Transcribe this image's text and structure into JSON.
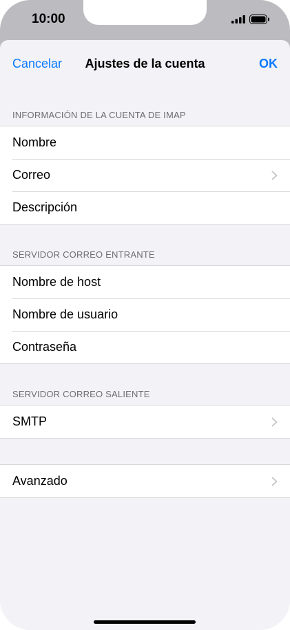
{
  "status_bar": {
    "time": "10:00",
    "signal_icon": "cellular-signal-icon",
    "battery_icon": "battery-icon"
  },
  "nav": {
    "cancel_label": "Cancelar",
    "title": "Ajustes de la cuenta",
    "ok_label": "OK"
  },
  "sections": {
    "imap": {
      "header": "INFORMACIÓN DE LA CUENTA DE IMAP",
      "rows": [
        {
          "label": "Nombre"
        },
        {
          "label": "Correo",
          "chevron": true
        },
        {
          "label": "Descripción"
        }
      ]
    },
    "incoming": {
      "header": "SERVIDOR CORREO ENTRANTE",
      "rows": [
        {
          "label": "Nombre de host"
        },
        {
          "label": "Nombre de usuario"
        },
        {
          "label": "Contraseña"
        }
      ]
    },
    "outgoing": {
      "header": "SERVIDOR CORREO SALIENTE",
      "rows": [
        {
          "label": "SMTP",
          "chevron": true
        }
      ]
    },
    "advanced": {
      "rows": [
        {
          "label": "Avanzado",
          "chevron": true
        }
      ]
    }
  },
  "colors": {
    "accent": "#0a7aff",
    "background": "#f2f2f7",
    "separator": "#d8d8dc",
    "section_header": "#6d6d72"
  }
}
